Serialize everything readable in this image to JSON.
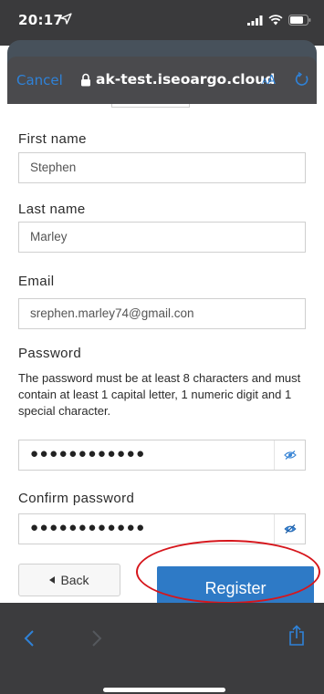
{
  "status_bar": {
    "time": "20:17"
  },
  "browser": {
    "cancel_label": "Cancel",
    "url": "ak-test.iseoargo.cloud",
    "aa_small": "A",
    "aa_large": "A"
  },
  "form": {
    "first_name": {
      "label": "First name",
      "value": "Stephen"
    },
    "last_name": {
      "label": "Last name",
      "value": "Marley"
    },
    "email": {
      "label": "Email",
      "value": "srephen.marley74@gmail.con"
    },
    "password": {
      "label": "Password",
      "help": "The password must be at least 8 characters and must contain at least 1 capital letter, 1 numeric digit and 1 special character.",
      "masked_value": "●●●●●●●●●●●●"
    },
    "confirm_password": {
      "label": "Confirm password",
      "masked_value": "●●●●●●●●●●●●"
    },
    "back_label": "Back",
    "register_label": "Register"
  },
  "colors": {
    "accent": "#2e7ac6",
    "highlight": "#d6161c",
    "chrome": "#3a3a3c"
  }
}
